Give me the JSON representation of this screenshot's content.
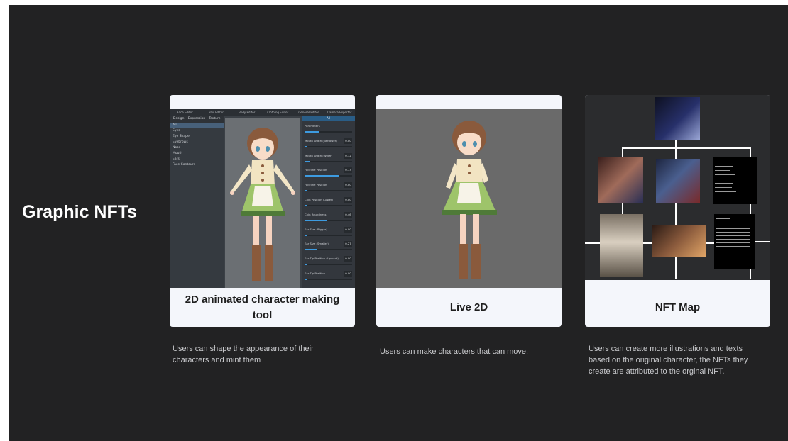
{
  "section": {
    "title": "Graphic NFTs"
  },
  "cards": [
    {
      "label": "2D animated character making tool",
      "description": "Users can shape the appearance of their characters and mint them",
      "editor": {
        "top_tabs": [
          "Face Editor",
          "Hair Editor",
          "Body Editor",
          "Clothing Editor",
          "General Editor",
          "Camera/Exporter"
        ],
        "left_tabs": [
          "Design",
          "Expression",
          "Texture"
        ],
        "left_items": [
          "All",
          "Eyes",
          "Eye Shape",
          "Eyebrows",
          "Nose",
          "Mouth",
          "Ears",
          "Face Contours"
        ],
        "right_header": "All",
        "params": [
          {
            "label": "Parameters",
            "value": "",
            "level": 0.3
          },
          {
            "label": "Mouth Width (Narrower)",
            "value": "0.00",
            "level": 0.0
          },
          {
            "label": "Mouth Width (Wider)",
            "value": "0.12",
            "level": 0.12
          },
          {
            "label": "Faceline Position",
            "value": "0.73",
            "level": 0.73
          },
          {
            "label": "Faceline Position",
            "value": "0.00",
            "level": 0.0
          },
          {
            "label": "Chin Position (Lower)",
            "value": "0.00",
            "level": 0.0
          },
          {
            "label": "Chin Roundness",
            "value": "0.46",
            "level": 0.46
          },
          {
            "label": "Ear Size (Bigger)",
            "value": "0.00",
            "level": 0.0
          },
          {
            "label": "Ear Size (Smaller)",
            "value": "0.27",
            "level": 0.27
          },
          {
            "label": "Ear Tip Position (Upward)",
            "value": "0.00",
            "level": 0.0
          },
          {
            "label": "Ear Tip Position",
            "value": "0.00",
            "level": 0.0
          }
        ]
      }
    },
    {
      "label": "Live 2D",
      "description": "Users can make characters that can move."
    },
    {
      "label": "NFT Map",
      "description": "Users can create more illustrations and texts based on the original character, the NFTs they create are attributed to the orginal NFT."
    }
  ],
  "colors": {
    "background": "#222223",
    "card": "#f4f6fb",
    "dress_green": "#9ec46a",
    "hair_brown": "#8a5a3c"
  }
}
